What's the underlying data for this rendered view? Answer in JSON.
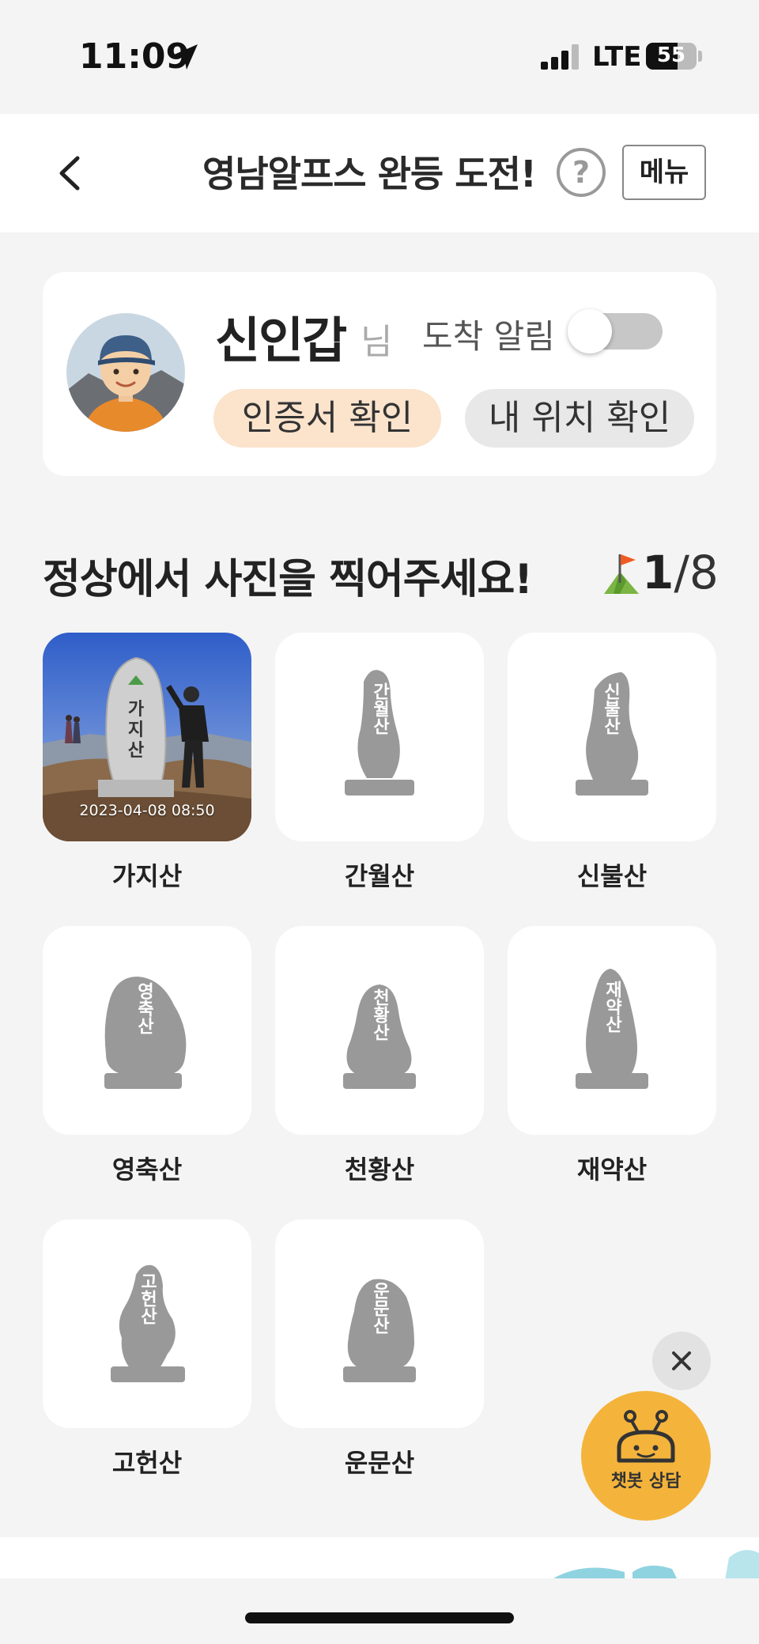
{
  "status_bar": {
    "time": "11:09",
    "network": "LTE",
    "battery": "55",
    "battery_level": 0.62
  },
  "header": {
    "title": "영남알프스 완등 도전!",
    "help_label": "?",
    "menu_label": "메뉴"
  },
  "profile": {
    "name": "신인갑",
    "suffix": "님",
    "arrival_label": "도착 알림",
    "arrival_enabled": false,
    "certificate_button": "인증서 확인",
    "location_button": "내 위치 확인"
  },
  "challenge": {
    "title": "정상에서 사진을 찍어주세요!",
    "completed": "1",
    "total": "/8"
  },
  "mountains": [
    {
      "name": "가지산",
      "completed": true,
      "photo_time": "2023-04-08 08:50"
    },
    {
      "name": "간월산",
      "completed": false
    },
    {
      "name": "신불산",
      "completed": false
    },
    {
      "name": "영축산",
      "completed": false
    },
    {
      "name": "천황산",
      "completed": false
    },
    {
      "name": "재약산",
      "completed": false
    },
    {
      "name": "고헌산",
      "completed": false
    },
    {
      "name": "운문산",
      "completed": false
    }
  ],
  "chatbot": {
    "label": "챗봇 상담"
  },
  "colors": {
    "accent": "#f4b43b",
    "certificate_bg": "#fbe3cc",
    "stone": "#999999"
  }
}
